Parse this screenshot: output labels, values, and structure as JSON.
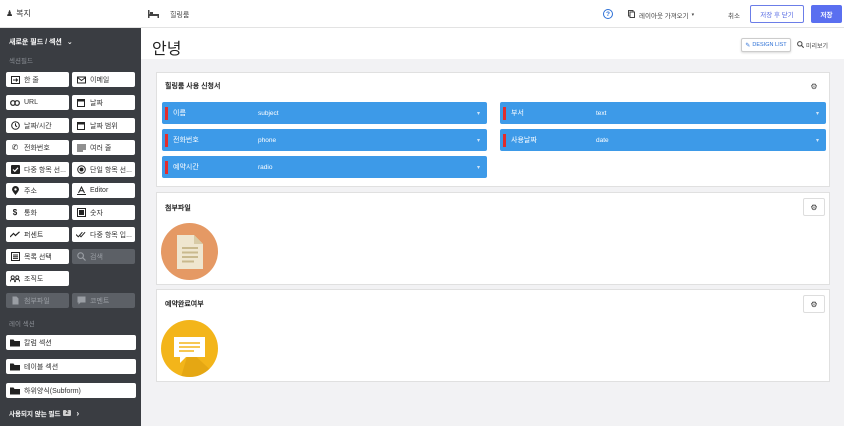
{
  "sidebar": {
    "header": "복지",
    "new_field_section": "새로운 필드 / 섹션",
    "section_field_label": "섹션필드",
    "fields": [
      {
        "label": "한 줄",
        "icon": "single-line-icon"
      },
      {
        "label": "이메일",
        "icon": "email-icon"
      },
      {
        "label": "URL",
        "icon": "link-icon"
      },
      {
        "label": "날짜",
        "icon": "calendar-icon"
      },
      {
        "label": "날짜/시간",
        "icon": "clock-icon"
      },
      {
        "label": "날짜 범위",
        "icon": "calendar-range-icon"
      },
      {
        "label": "전화번호",
        "icon": "phone-icon"
      },
      {
        "label": "여러 줄",
        "icon": "multi-line-icon"
      },
      {
        "label": "다중 항목 선...",
        "icon": "checkbox-icon"
      },
      {
        "label": "단일 항목 선...",
        "icon": "radio-icon"
      },
      {
        "label": "주소",
        "icon": "map-pin-icon"
      },
      {
        "label": "Editor",
        "icon": "editor-icon"
      },
      {
        "label": "통화",
        "icon": "dollar-icon"
      },
      {
        "label": "숫자",
        "icon": "number-icon"
      },
      {
        "label": "퍼센트",
        "icon": "trend-icon"
      },
      {
        "label": "다중 항목 입...",
        "icon": "double-check-icon"
      },
      {
        "label": "목록 선택",
        "icon": "list-icon"
      },
      {
        "label": "검색",
        "icon": "search-icon"
      },
      {
        "label": "조직도",
        "icon": "org-chart-icon"
      },
      {
        "label": "첨부파일",
        "icon": "attachment-icon"
      },
      {
        "label": "코멘트",
        "icon": "comment-icon"
      }
    ],
    "layout_section_label": "레이 섹션",
    "layout_sections": [
      {
        "label": "칼럼 섹션",
        "icon": "folder-icon"
      },
      {
        "label": "테이블 섹션",
        "icon": "folder-icon"
      },
      {
        "label": "하위양식(Subform)",
        "icon": "folder-icon"
      }
    ],
    "unused_fields": "사용되지 않는 필드",
    "unused_count": "2"
  },
  "topbar": {
    "title": "힐링룸",
    "help": "?",
    "layout_import": "레이아웃 가져오기",
    "cancel": "취소",
    "save_close": "저장 후 닫기",
    "save": "저장"
  },
  "page": {
    "title": "안녕",
    "design_list": "DESIGN LIST",
    "preview": "미리보기"
  },
  "form_card": {
    "title": "힐링룸 사용 신청서",
    "fields": [
      {
        "label": "이름",
        "value": "subject"
      },
      {
        "label": "부서",
        "value": "text"
      },
      {
        "label": "전화번호",
        "value": "phone"
      },
      {
        "label": "사용날짜",
        "value": "date"
      },
      {
        "label": "예약시간",
        "value": "radio"
      }
    ]
  },
  "attachment_card": {
    "title": "첨부파일"
  },
  "reservation_card": {
    "title": "예약완료여부"
  },
  "colors": {
    "sidebar_bg": "#3a3d42",
    "field_blue": "#3d9ae8",
    "required_red": "#e22d2d",
    "save_button": "#5a6ff0"
  }
}
